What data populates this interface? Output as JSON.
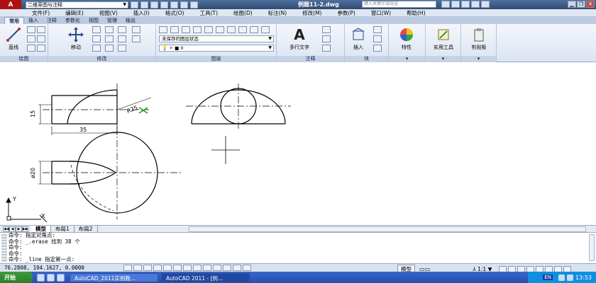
{
  "titlebar": {
    "workspace": "二维草图与注释",
    "document_title": "例题11-2.dwg",
    "search_placeholder": "键入关键字或短语",
    "close_glyph": "✕",
    "minimize_glyph": "▁",
    "restore_glyph": "❐"
  },
  "menu": [
    "文件(F)",
    "编辑(E)",
    "视图(V)",
    "插入(I)",
    "格式(O)",
    "工具(T)",
    "绘图(D)",
    "标注(N)",
    "修改(M)",
    "参数(P)",
    "窗口(W)",
    "帮助(H)"
  ],
  "ribbon_tabs": [
    "常用",
    "插入",
    "注释",
    "参数化",
    "视图",
    "管理",
    "输出"
  ],
  "ribbon": {
    "draw_panel": "绘图",
    "line_label": "直线",
    "modify_panel": "修改",
    "move_label": "移动",
    "layer_panel": "图层",
    "layer_state": "未保存的图层状态",
    "layer_current": "0",
    "annotation_panel": "注释",
    "mtext_label": "多行文字",
    "block_panel": "块",
    "insert_label": "插入",
    "properties_label": "特性",
    "utilities_label": "实用工具",
    "clipboard_label": "剪贴板"
  },
  "drawing": {
    "dim_height": "15",
    "dim_length": "35",
    "dim_radius": "R25",
    "dim_diameter": "ø20",
    "ucs_x": "X",
    "ucs_y": "Y"
  },
  "layout_tabs": [
    "模型",
    "布局1",
    "布局2"
  ],
  "command_lines": [
    "命令: 指定对角点:",
    "命令: _.erase 找到 38 个",
    "命令:",
    "命令:",
    "命令: _line 指定第一点:"
  ],
  "status": {
    "coords": "76.2808, 194.1627, 0.0000",
    "model": "模型",
    "scale": "1:1"
  },
  "taskbar": {
    "start": "开始",
    "task1": "AutoCAD_2011实例教...",
    "task2": "AutoCAD 2011 - [例...",
    "lang": "EN",
    "clock": "13:53"
  }
}
